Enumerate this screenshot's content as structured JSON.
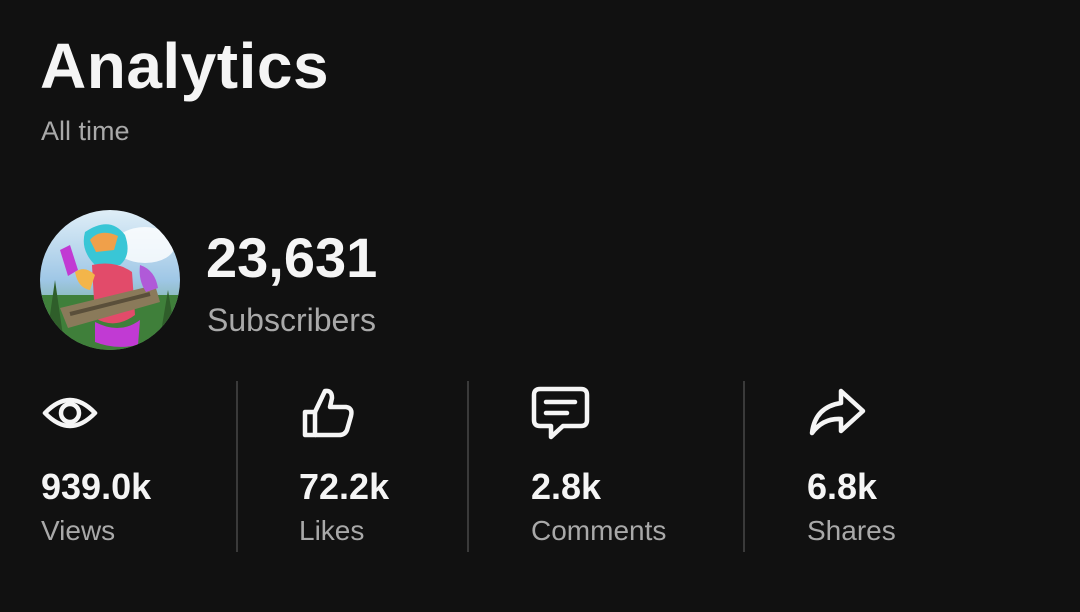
{
  "header": {
    "title": "Analytics",
    "subtitle": "All time"
  },
  "channel": {
    "avatar_icon": "channel-avatar-image",
    "subscriber_count": "23,631",
    "subscriber_label": "Subscribers"
  },
  "stats": [
    {
      "icon": "eye-icon",
      "value": "939.0k",
      "label": "Views"
    },
    {
      "icon": "thumbs-up-icon",
      "value": "72.2k",
      "label": "Likes"
    },
    {
      "icon": "comment-icon",
      "value": "2.8k",
      "label": "Comments"
    },
    {
      "icon": "share-icon",
      "value": "6.8k",
      "label": "Shares"
    }
  ],
  "colors": {
    "background": "#111111",
    "primary_text": "#f5f5f5",
    "secondary_text": "#a9a9a9",
    "divider": "#3a3a3a"
  }
}
